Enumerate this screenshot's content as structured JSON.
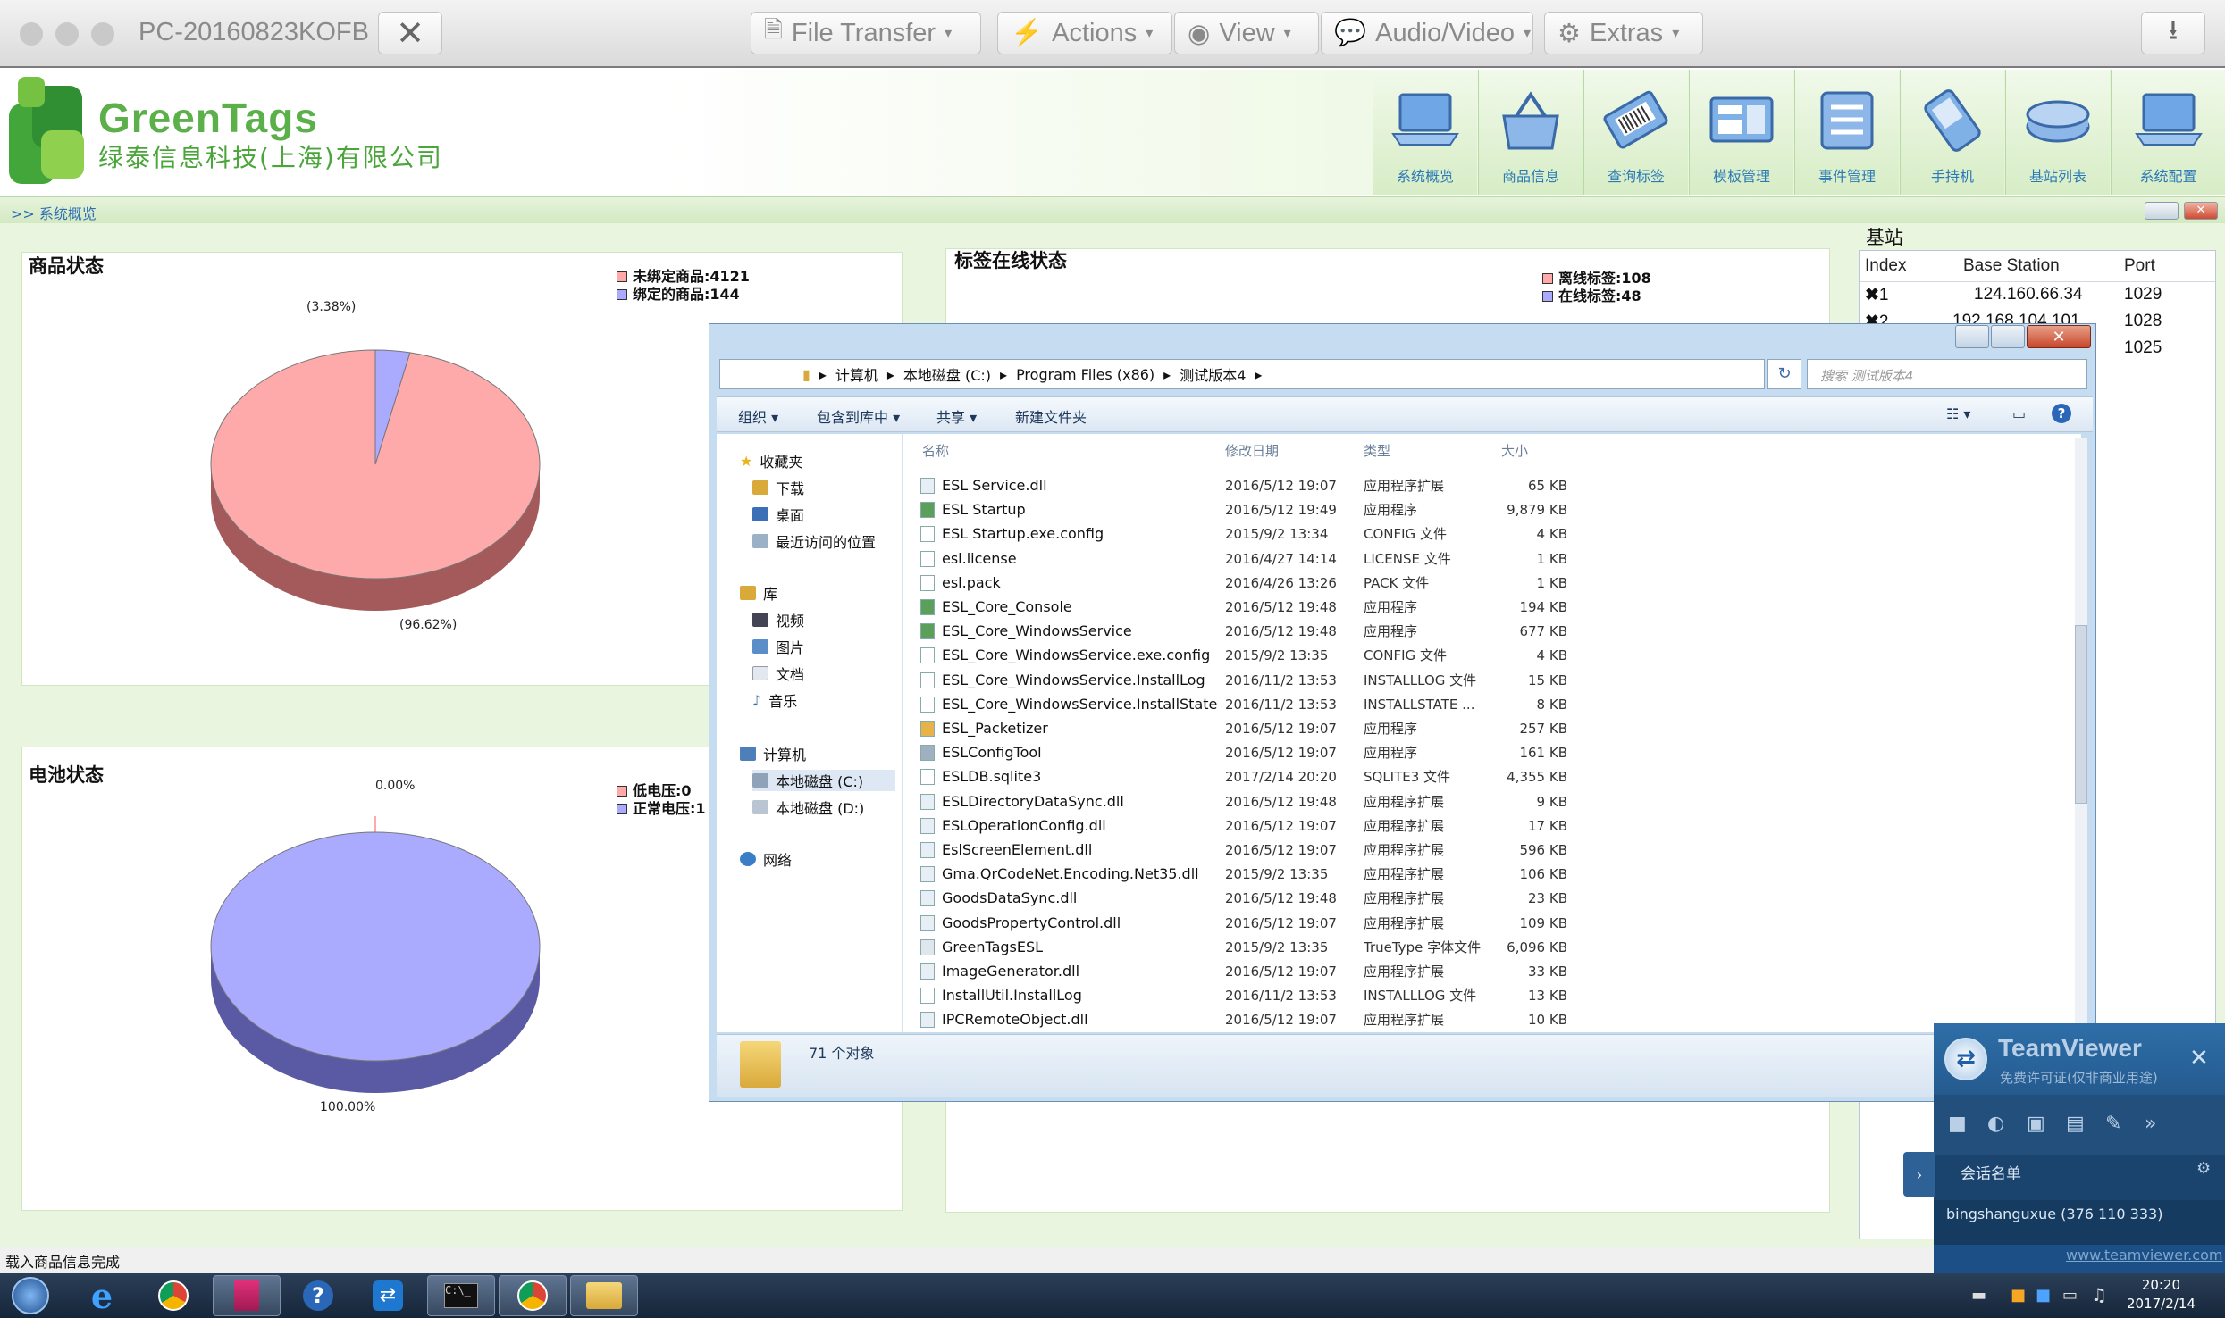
{
  "tv_bar": {
    "pc_name": "PC-20160823KOFB",
    "menus": [
      {
        "label": "File Transfer"
      },
      {
        "label": "Actions"
      },
      {
        "label": "View"
      },
      {
        "label": "Audio/Video"
      },
      {
        "label": "Extras"
      }
    ]
  },
  "app": {
    "logo_title": "GreenTags",
    "logo_subtitle": "绿泰信息科技(上海)有限公司",
    "nav": [
      {
        "label": "系统概览"
      },
      {
        "label": "商品信息"
      },
      {
        "label": "查询标签"
      },
      {
        "label": "模板管理"
      },
      {
        "label": "事件管理"
      },
      {
        "label": "手持机"
      },
      {
        "label": "基站列表"
      },
      {
        "label": "系统配置"
      }
    ],
    "breadcrumb": ">> 系统概览",
    "status_text": "载入商品信息完成"
  },
  "panels": {
    "goods": {
      "title": "商品状态",
      "legend": [
        "未绑定商品:4121",
        "绑定的商品:144"
      ],
      "label_small": "(3.38%)",
      "label_large": "(96.62%)",
      "colors": {
        "unbound": "#ffaaaa",
        "bound": "#aaaaff"
      }
    },
    "tags": {
      "title": "标签在线状态",
      "legend": [
        "离线标签:108",
        "在线标签:48"
      ]
    },
    "battery": {
      "title": "电池状态",
      "legend": [
        "低电压:0",
        "正常电压:1"
      ],
      "label_small": "0.00%",
      "label_large": "100.00%",
      "colors": {
        "low": "#ffaaaa",
        "normal": "#aaaaff"
      }
    }
  },
  "chart_data": [
    {
      "type": "pie",
      "title": "商品状态",
      "series": [
        {
          "name": "未绑定商品:4121",
          "values": [
            96.62
          ]
        },
        {
          "name": "绑定的商品:144",
          "values": [
            3.38
          ]
        }
      ]
    },
    {
      "type": "pie",
      "title": "电池状态",
      "series": [
        {
          "name": "低电压:0",
          "values": [
            0.0
          ]
        },
        {
          "name": "正常电压:1",
          "values": [
            100.0
          ]
        }
      ]
    }
  ],
  "base_station": {
    "title": "基站",
    "headers": [
      "Index",
      "Base Station",
      "Port"
    ],
    "rows": [
      {
        "index": "1",
        "station": "124.160.66.34",
        "port": "1029"
      },
      {
        "index": "2",
        "station": "192.168.104.101",
        "port": "1028"
      },
      {
        "index": "",
        "station": "",
        "port": "1025"
      }
    ]
  },
  "explorer": {
    "path": [
      "计算机",
      "本地磁盘 (C:)",
      "Program Files (x86)",
      "测试版本4"
    ],
    "search_placeholder": "搜索 测试版本4",
    "toolbar": [
      "组织",
      "包含到库中",
      "共享",
      "新建文件夹"
    ],
    "nav": {
      "favorites": "收藏夹",
      "fav_items": [
        "下载",
        "桌面",
        "最近访问的位置"
      ],
      "libraries": "库",
      "lib_items": [
        "视频",
        "图片",
        "文档",
        "音乐"
      ],
      "computer": "计算机",
      "drives": [
        "本地磁盘 (C:)",
        "本地磁盘 (D:)"
      ],
      "network": "网络"
    },
    "columns": [
      "名称",
      "修改日期",
      "类型",
      "大小"
    ],
    "files": [
      {
        "name": "ESL Service.dll",
        "date": "2016/5/12 19:07",
        "type": "应用程序扩展",
        "size": "65 KB",
        "icon": "dll"
      },
      {
        "name": "ESL Startup",
        "date": "2016/5/12 19:49",
        "type": "应用程序",
        "size": "9,879 KB",
        "icon": "exe"
      },
      {
        "name": "ESL Startup.exe.config",
        "date": "2015/9/2 13:34",
        "type": "CONFIG 文件",
        "size": "4 KB",
        "icon": "file"
      },
      {
        "name": "esl.license",
        "date": "2016/4/27 14:14",
        "type": "LICENSE 文件",
        "size": "1 KB",
        "icon": "file"
      },
      {
        "name": "esl.pack",
        "date": "2016/4/26 13:26",
        "type": "PACK 文件",
        "size": "1 KB",
        "icon": "file"
      },
      {
        "name": "ESL_Core_Console",
        "date": "2016/5/12 19:48",
        "type": "应用程序",
        "size": "194 KB",
        "icon": "exe"
      },
      {
        "name": "ESL_Core_WindowsService",
        "date": "2016/5/12 19:48",
        "type": "应用程序",
        "size": "677 KB",
        "icon": "exe"
      },
      {
        "name": "ESL_Core_WindowsService.exe.config",
        "date": "2015/9/2 13:35",
        "type": "CONFIG 文件",
        "size": "4 KB",
        "icon": "file"
      },
      {
        "name": "ESL_Core_WindowsService.InstallLog",
        "date": "2016/11/2 13:53",
        "type": "INSTALLLOG 文件",
        "size": "15 KB",
        "icon": "file"
      },
      {
        "name": "ESL_Core_WindowsService.InstallState",
        "date": "2016/11/2 13:53",
        "type": "INSTALLSTATE ...",
        "size": "8 KB",
        "icon": "file"
      },
      {
        "name": "ESL_Packetizer",
        "date": "2016/5/12 19:07",
        "type": "应用程序",
        "size": "257 KB",
        "icon": "folderexe"
      },
      {
        "name": "ESLConfigTool",
        "date": "2016/5/12 19:07",
        "type": "应用程序",
        "size": "161 KB",
        "icon": "tool"
      },
      {
        "name": "ESLDB.sqlite3",
        "date": "2017/2/14 20:20",
        "type": "SQLITE3 文件",
        "size": "4,355 KB",
        "icon": "file"
      },
      {
        "name": "ESLDirectoryDataSync.dll",
        "date": "2016/5/12 19:48",
        "type": "应用程序扩展",
        "size": "9 KB",
        "icon": "dll"
      },
      {
        "name": "ESLOperationConfig.dll",
        "date": "2016/5/12 19:07",
        "type": "应用程序扩展",
        "size": "17 KB",
        "icon": "dll"
      },
      {
        "name": "EslScreenElement.dll",
        "date": "2016/5/12 19:07",
        "type": "应用程序扩展",
        "size": "596 KB",
        "icon": "dll"
      },
      {
        "name": "Gma.QrCodeNet.Encoding.Net35.dll",
        "date": "2015/9/2 13:35",
        "type": "应用程序扩展",
        "size": "106 KB",
        "icon": "dll"
      },
      {
        "name": "GoodsDataSync.dll",
        "date": "2016/5/12 19:48",
        "type": "应用程序扩展",
        "size": "23 KB",
        "icon": "dll"
      },
      {
        "name": "GoodsPropertyControl.dll",
        "date": "2016/5/12 19:07",
        "type": "应用程序扩展",
        "size": "109 KB",
        "icon": "dll"
      },
      {
        "name": "GreenTagsESL",
        "date": "2015/9/2 13:35",
        "type": "TrueType 字体文件",
        "size": "6,096 KB",
        "icon": "font"
      },
      {
        "name": "ImageGenerator.dll",
        "date": "2016/5/12 19:07",
        "type": "应用程序扩展",
        "size": "33 KB",
        "icon": "dll"
      },
      {
        "name": "InstallUtil.InstallLog",
        "date": "2016/11/2 13:53",
        "type": "INSTALLLOG 文件",
        "size": "13 KB",
        "icon": "file"
      },
      {
        "name": "IPCRemoteObject.dll",
        "date": "2016/5/12 19:07",
        "type": "应用程序扩展",
        "size": "10 KB",
        "icon": "dll"
      }
    ],
    "count": "71 个对象"
  },
  "teamviewer": {
    "title": "TeamViewer",
    "subtitle": "免费许可证(仅非商业用途)",
    "session_label": "会话名单",
    "partner": "bingshanguxue (376 110 333)",
    "link": "www.teamviewer.com"
  },
  "taskbar": {
    "time": "20:20",
    "date": "2017/2/14"
  }
}
